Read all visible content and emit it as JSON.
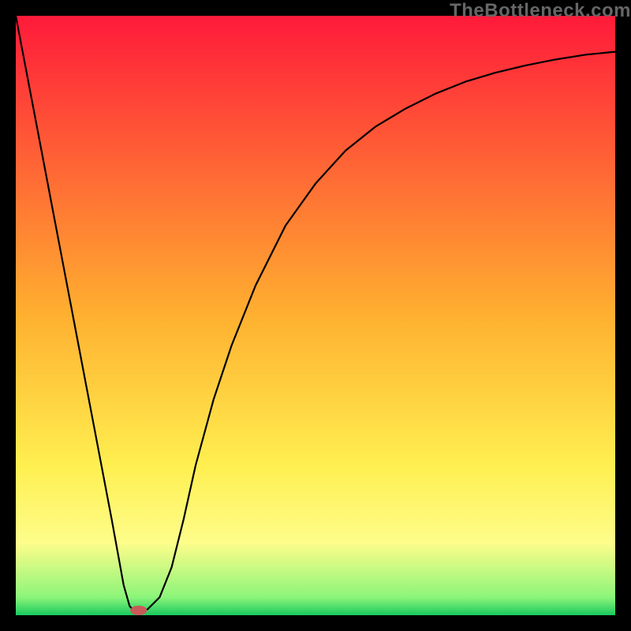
{
  "watermark": {
    "text": "TheBottleneck.com"
  },
  "chart_data": {
    "type": "line",
    "title": "",
    "xlabel": "",
    "ylabel": "",
    "xlim": [
      0,
      100
    ],
    "ylim": [
      0,
      100
    ],
    "grid": false,
    "background_gradient": {
      "stops": [
        {
          "pos": 0.0,
          "color": "#ff1a3a"
        },
        {
          "pos": 0.5,
          "color": "#ffb030"
        },
        {
          "pos": 0.75,
          "color": "#ffef50"
        },
        {
          "pos": 0.88,
          "color": "#fdfd8a"
        },
        {
          "pos": 0.97,
          "color": "#8cf57a"
        },
        {
          "pos": 1.0,
          "color": "#18c95e"
        }
      ]
    },
    "series": [
      {
        "name": "bottleneck-curve",
        "color": "#000000",
        "x": [
          0,
          2,
          4,
          6,
          8,
          10,
          12,
          14,
          16,
          17,
          18,
          19,
          20,
          21,
          22,
          24,
          26,
          28,
          30,
          33,
          36,
          40,
          45,
          50,
          55,
          60,
          65,
          70,
          75,
          80,
          85,
          90,
          95,
          100
        ],
        "y": [
          100,
          89.5,
          79,
          68.5,
          58,
          47.5,
          37,
          26.5,
          16,
          10.5,
          5,
          1.5,
          0.5,
          0.5,
          1,
          3,
          8,
          16,
          25,
          36,
          45,
          55,
          65,
          72,
          77.5,
          81.5,
          84.5,
          87,
          89,
          90.5,
          91.7,
          92.7,
          93.5,
          94
        ]
      }
    ],
    "marker": {
      "name": "optimal-point",
      "x": 20.5,
      "y": 0.8,
      "color": "#c85a5a",
      "rx": 1.4,
      "ry": 0.8
    }
  }
}
